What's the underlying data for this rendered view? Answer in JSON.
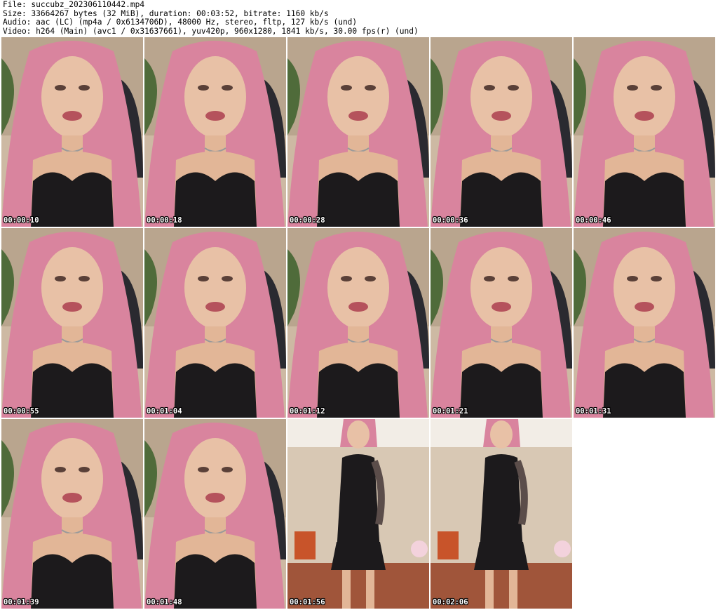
{
  "header": {
    "file": "File: succubz_202306110442.mp4",
    "size": "Size: 33664267 bytes (32 MiB), duration: 00:03:52, bitrate: 1160 kb/s",
    "audio": "Audio: aac (LC) (mp4a / 0x6134706D), 48000 Hz, stereo, fltp, 127 kb/s (und)",
    "video": "Video: h264 (Main) (avc1 / 0x31637661), yuv420p, 960x1280, 1841 kb/s, 30.00 fps(r) (und)"
  },
  "thumbnails": [
    {
      "timestamp": "00:00:10",
      "scene": "closeup"
    },
    {
      "timestamp": "00:00:18",
      "scene": "closeup"
    },
    {
      "timestamp": "00:00:28",
      "scene": "closeup"
    },
    {
      "timestamp": "00:00:36",
      "scene": "closeup"
    },
    {
      "timestamp": "00:00:46",
      "scene": "closeup"
    },
    {
      "timestamp": "00:00:55",
      "scene": "closeup"
    },
    {
      "timestamp": "00:01:04",
      "scene": "closeup"
    },
    {
      "timestamp": "00:01:12",
      "scene": "closeup"
    },
    {
      "timestamp": "00:01:21",
      "scene": "closeup"
    },
    {
      "timestamp": "00:01:31",
      "scene": "closeup"
    },
    {
      "timestamp": "00:01:39",
      "scene": "closeup"
    },
    {
      "timestamp": "00:01:48",
      "scene": "closeup"
    },
    {
      "timestamp": "00:01:56",
      "scene": "fullbody"
    },
    {
      "timestamp": "00:02:06",
      "scene": "fullbody"
    }
  ],
  "colors": {
    "background": "#ffffff",
    "hair": "#d9849e",
    "skin": "#e8c1a6",
    "garment": "#1c1a1c",
    "room": "#d8c8b4"
  }
}
